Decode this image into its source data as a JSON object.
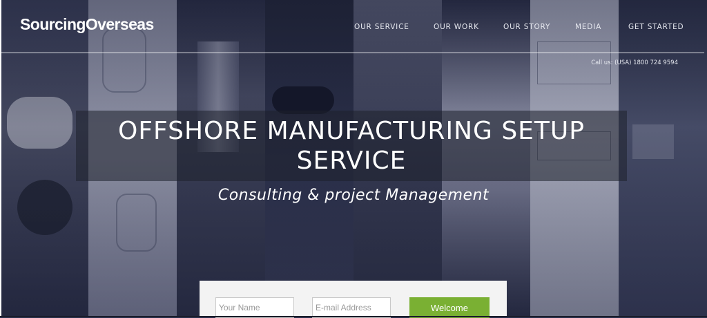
{
  "brand": {
    "logo_text": "SourcingOverseas"
  },
  "nav": {
    "items": [
      {
        "label": "OUR SERVICE"
      },
      {
        "label": "OUR WORK"
      },
      {
        "label": "OUR STORY"
      },
      {
        "label": "MEDIA"
      },
      {
        "label": "GET STARTED"
      }
    ]
  },
  "contact": {
    "phone_text": "Call us: (USA) 1800 724 9594"
  },
  "hero": {
    "headline_line1": "OFFSHORE MANUFACTURING SETUP",
    "headline_line2": "SERVICE",
    "subheadline": "Consulting & project Management"
  },
  "signup_form": {
    "name_placeholder": "Your Name",
    "email_placeholder": "E-mail Address",
    "submit_label": "Welcome"
  },
  "colors": {
    "accent_green": "#7ab033",
    "overlay_navy": "#2c3350",
    "headline_box": "#1e202c"
  }
}
